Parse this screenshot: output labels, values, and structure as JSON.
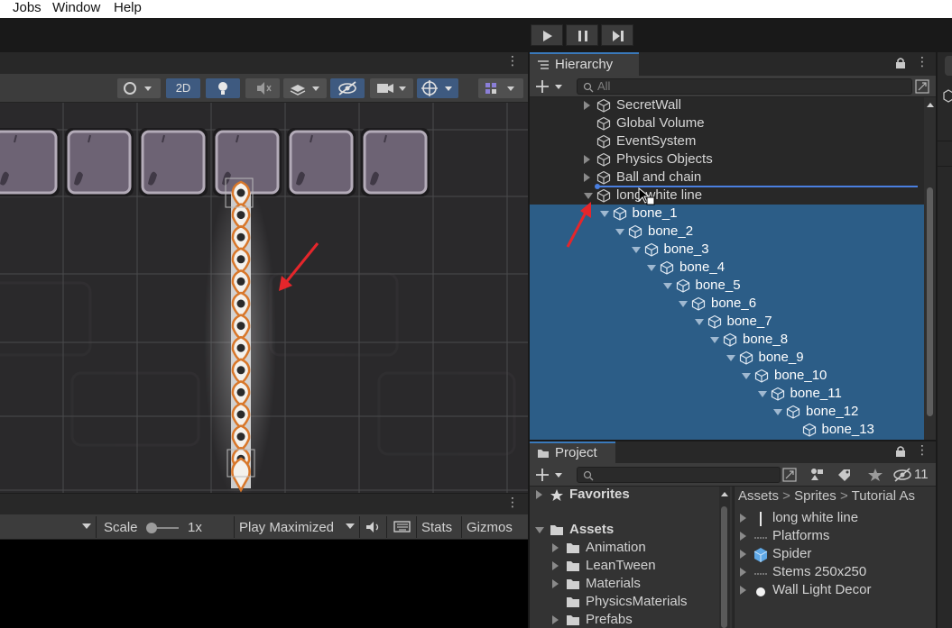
{
  "menubar": {
    "items": [
      "Jobs",
      "Window",
      "Help"
    ]
  },
  "scene": {
    "toolbar": {
      "toggle_2d": "2D"
    }
  },
  "game": {
    "toolbar": {
      "scale_label": "Scale",
      "scale_value": "1x",
      "play_mode": "Play Maximized",
      "stats": "Stats",
      "gizmos": "Gizmos"
    }
  },
  "hierarchy": {
    "title": "Hierarchy",
    "search_placeholder": "All",
    "items": [
      {
        "label": "SecretWall",
        "depth": 0,
        "arrow": "right",
        "selected": false
      },
      {
        "label": "Global Volume",
        "depth": 0,
        "arrow": "none",
        "selected": false
      },
      {
        "label": "EventSystem",
        "depth": 0,
        "arrow": "none",
        "selected": false
      },
      {
        "label": "Physics Objects",
        "depth": 0,
        "arrow": "right",
        "selected": false
      },
      {
        "label": "Ball and chain",
        "depth": 0,
        "arrow": "right",
        "selected": false
      },
      {
        "label": "long white line",
        "depth": 0,
        "arrow": "down",
        "selected": false
      },
      {
        "label": "bone_1",
        "depth": 1,
        "arrow": "down",
        "selected": true
      },
      {
        "label": "bone_2",
        "depth": 2,
        "arrow": "down",
        "selected": true
      },
      {
        "label": "bone_3",
        "depth": 3,
        "arrow": "down",
        "selected": true
      },
      {
        "label": "bone_4",
        "depth": 4,
        "arrow": "down",
        "selected": true
      },
      {
        "label": "bone_5",
        "depth": 5,
        "arrow": "down",
        "selected": true
      },
      {
        "label": "bone_6",
        "depth": 6,
        "arrow": "down",
        "selected": true
      },
      {
        "label": "bone_7",
        "depth": 7,
        "arrow": "down",
        "selected": true
      },
      {
        "label": "bone_8",
        "depth": 8,
        "arrow": "down",
        "selected": true
      },
      {
        "label": "bone_9",
        "depth": 9,
        "arrow": "down",
        "selected": true
      },
      {
        "label": "bone_10",
        "depth": 10,
        "arrow": "down",
        "selected": true
      },
      {
        "label": "bone_11",
        "depth": 11,
        "arrow": "down",
        "selected": true
      },
      {
        "label": "bone_12",
        "depth": 12,
        "arrow": "down",
        "selected": true
      },
      {
        "label": "bone_13",
        "depth": 13,
        "arrow": "none",
        "selected": true
      }
    ]
  },
  "project": {
    "title": "Project",
    "hidden_count": "11",
    "tree": [
      {
        "label": "Favorites",
        "kind": "star",
        "bold": true,
        "arrow": true
      },
      {
        "label": "Assets",
        "kind": "folder",
        "bold": true,
        "arrow": true
      },
      {
        "label": "Animation",
        "kind": "folder",
        "bold": false,
        "arrow": true
      },
      {
        "label": "LeanTween",
        "kind": "folder",
        "bold": false,
        "arrow": true
      },
      {
        "label": "Materials",
        "kind": "folder",
        "bold": false,
        "arrow": true
      },
      {
        "label": "PhysicsMaterials",
        "kind": "folder",
        "bold": false,
        "arrow": false
      },
      {
        "label": "Prefabs",
        "kind": "folder",
        "bold": false,
        "arrow": true
      }
    ],
    "breadcrumb": [
      "Assets",
      "Sprites",
      "Tutorial As"
    ],
    "assets": [
      {
        "label": "long white line",
        "kind": "line-sprite"
      },
      {
        "label": "Platforms",
        "kind": "dash-sprite"
      },
      {
        "label": "Spider",
        "kind": "prefab"
      },
      {
        "label": "Stems 250x250",
        "kind": "dash-sprite"
      },
      {
        "label": "Wall Light Decor",
        "kind": "light-sprite"
      }
    ]
  },
  "colors": {
    "selection": "#2c5d87",
    "accent_blue": "#3e5a80",
    "rope_orange": "#d8772a",
    "annotation_red": "#e5262b"
  }
}
